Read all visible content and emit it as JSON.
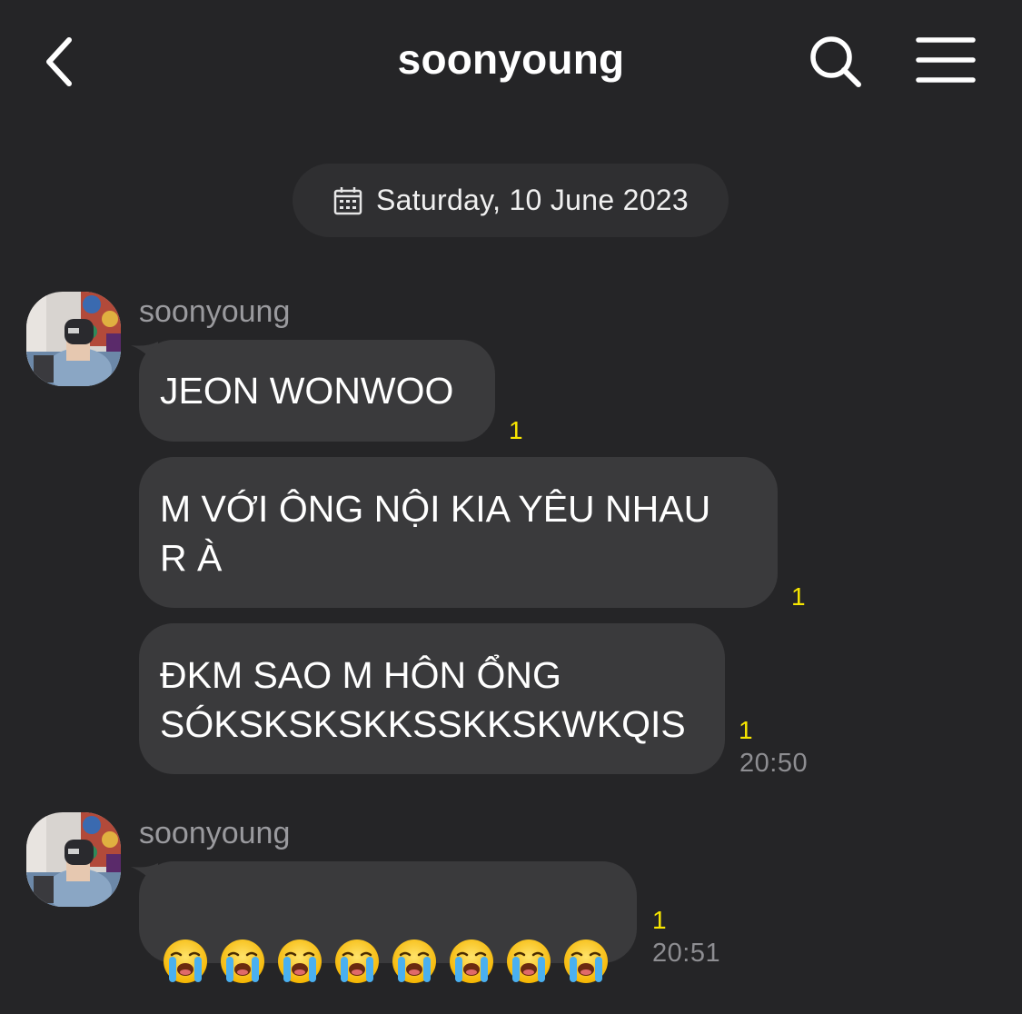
{
  "header": {
    "title": "soonyoung",
    "back_icon": "chevron-left-icon",
    "search_icon": "search-icon",
    "menu_icon": "hamburger-menu-icon"
  },
  "date_divider": {
    "icon": "calendar-icon",
    "text": "Saturday, 10 June 2023"
  },
  "groups": [
    {
      "sender": "soonyoung",
      "messages": [
        {
          "text": "JEON WONWOO",
          "unread": "1",
          "time": ""
        },
        {
          "text": "M VỚI ÔNG NỘI KIA YÊU NHAU\nR À",
          "unread": "1",
          "time": ""
        },
        {
          "text": "ĐKM SAO M HÔN ỔNG\nSÓKSKSKSKKSSKKSKWKQIS",
          "unread": "1",
          "time": "20:50"
        }
      ]
    },
    {
      "sender": "soonyoung",
      "messages": [
        {
          "text": "",
          "emoji": "loudly-crying-face-icon",
          "emoji_count": 8,
          "unread": "1",
          "time": "20:51"
        }
      ]
    }
  ],
  "colors": {
    "background": "#252527",
    "bubble": "#3a3a3c",
    "unread": "#f7e600",
    "muted": "#8e8e92"
  }
}
